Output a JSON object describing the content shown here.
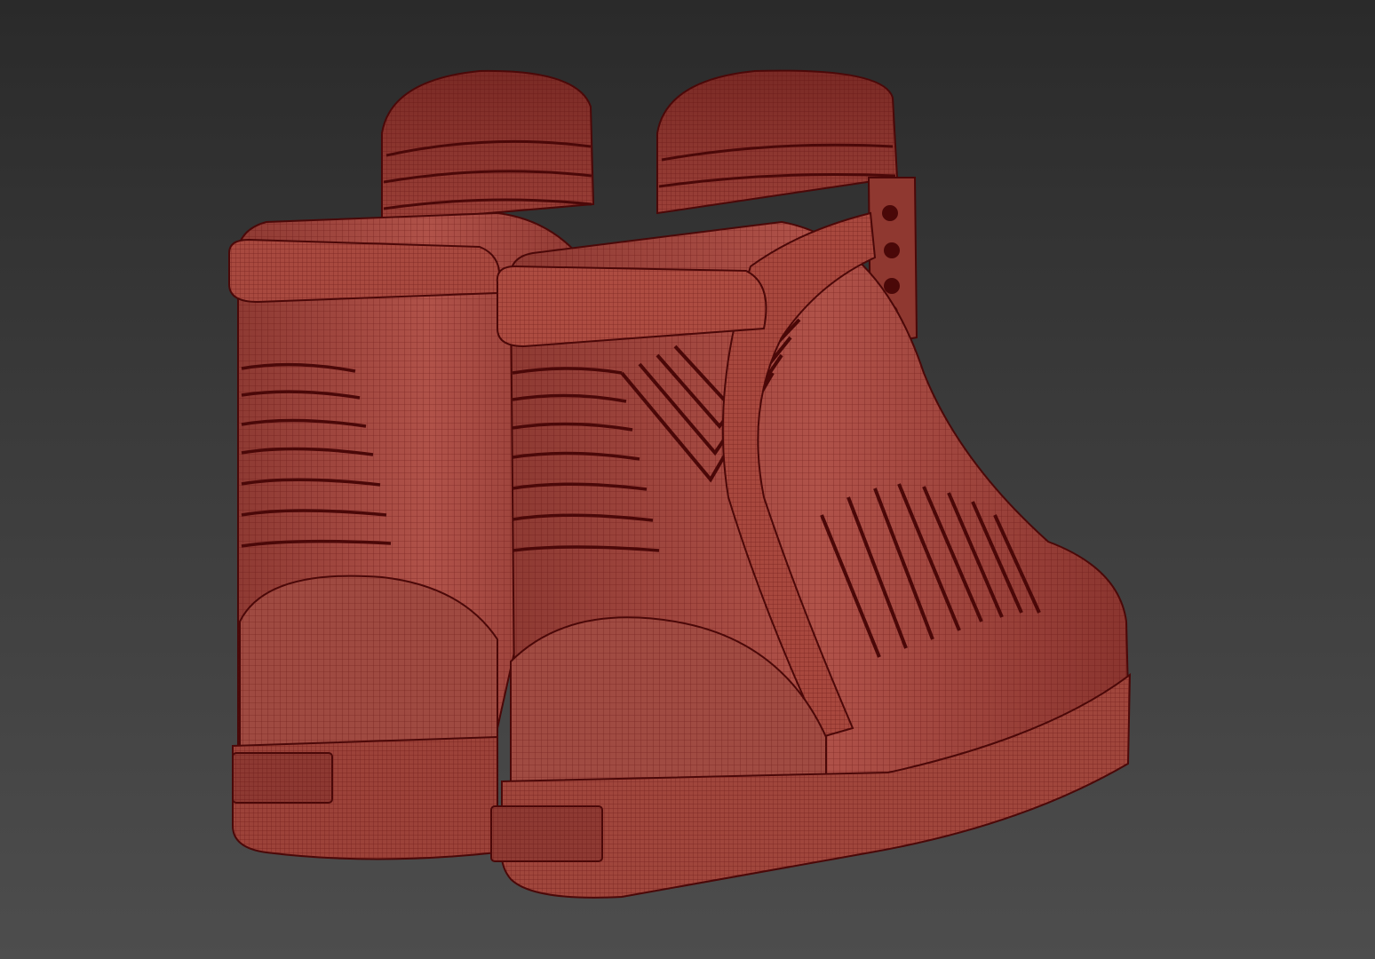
{
  "viewport": {
    "background_top": "#2a2a2a",
    "background_bottom": "#4d4d4d",
    "wire_color": "#5a0a0a",
    "mesh_fill": "#a5483f",
    "mesh_fill_dark": "#7c2c26",
    "mesh_fill_light": "#b85b50"
  },
  "objects": [
    {
      "name": "left-shoe-mesh",
      "kind": "high-top sneaker wireframe"
    },
    {
      "name": "right-shoe-mesh",
      "kind": "high-top sneaker wireframe"
    }
  ]
}
